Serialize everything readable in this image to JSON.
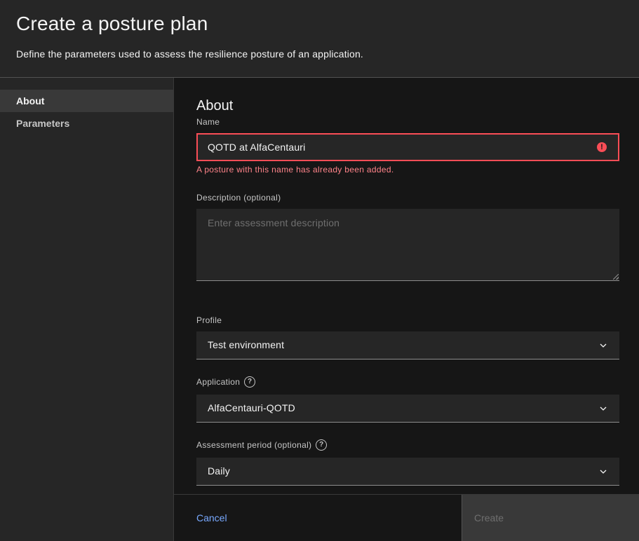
{
  "header": {
    "title": "Create a posture plan",
    "subtitle": "Define the parameters used to assess the resilience posture of an application."
  },
  "sidenav": {
    "items": [
      {
        "label": "About",
        "active": true
      },
      {
        "label": "Parameters",
        "active": false
      }
    ]
  },
  "main": {
    "section_title": "About",
    "name": {
      "label": "Name",
      "value": "QOTD at AlfaCentauri",
      "error": "A posture with this name has already been added."
    },
    "description": {
      "label": "Description (optional)",
      "placeholder": "Enter assessment description"
    },
    "profile": {
      "label": "Profile",
      "value": "Test environment"
    },
    "application": {
      "label": "Application",
      "value": "AlfaCentauri-QOTD"
    },
    "assessment_period": {
      "label": "Assessment period (optional)",
      "value": "Daily"
    }
  },
  "footer": {
    "cancel_label": "Cancel",
    "create_label": "Create"
  },
  "icons": {
    "error": "error-icon",
    "chevron": "chevron-down-icon",
    "help": "help-icon"
  },
  "colors": {
    "error": "#fa4d56",
    "link": "#78a9ff"
  }
}
